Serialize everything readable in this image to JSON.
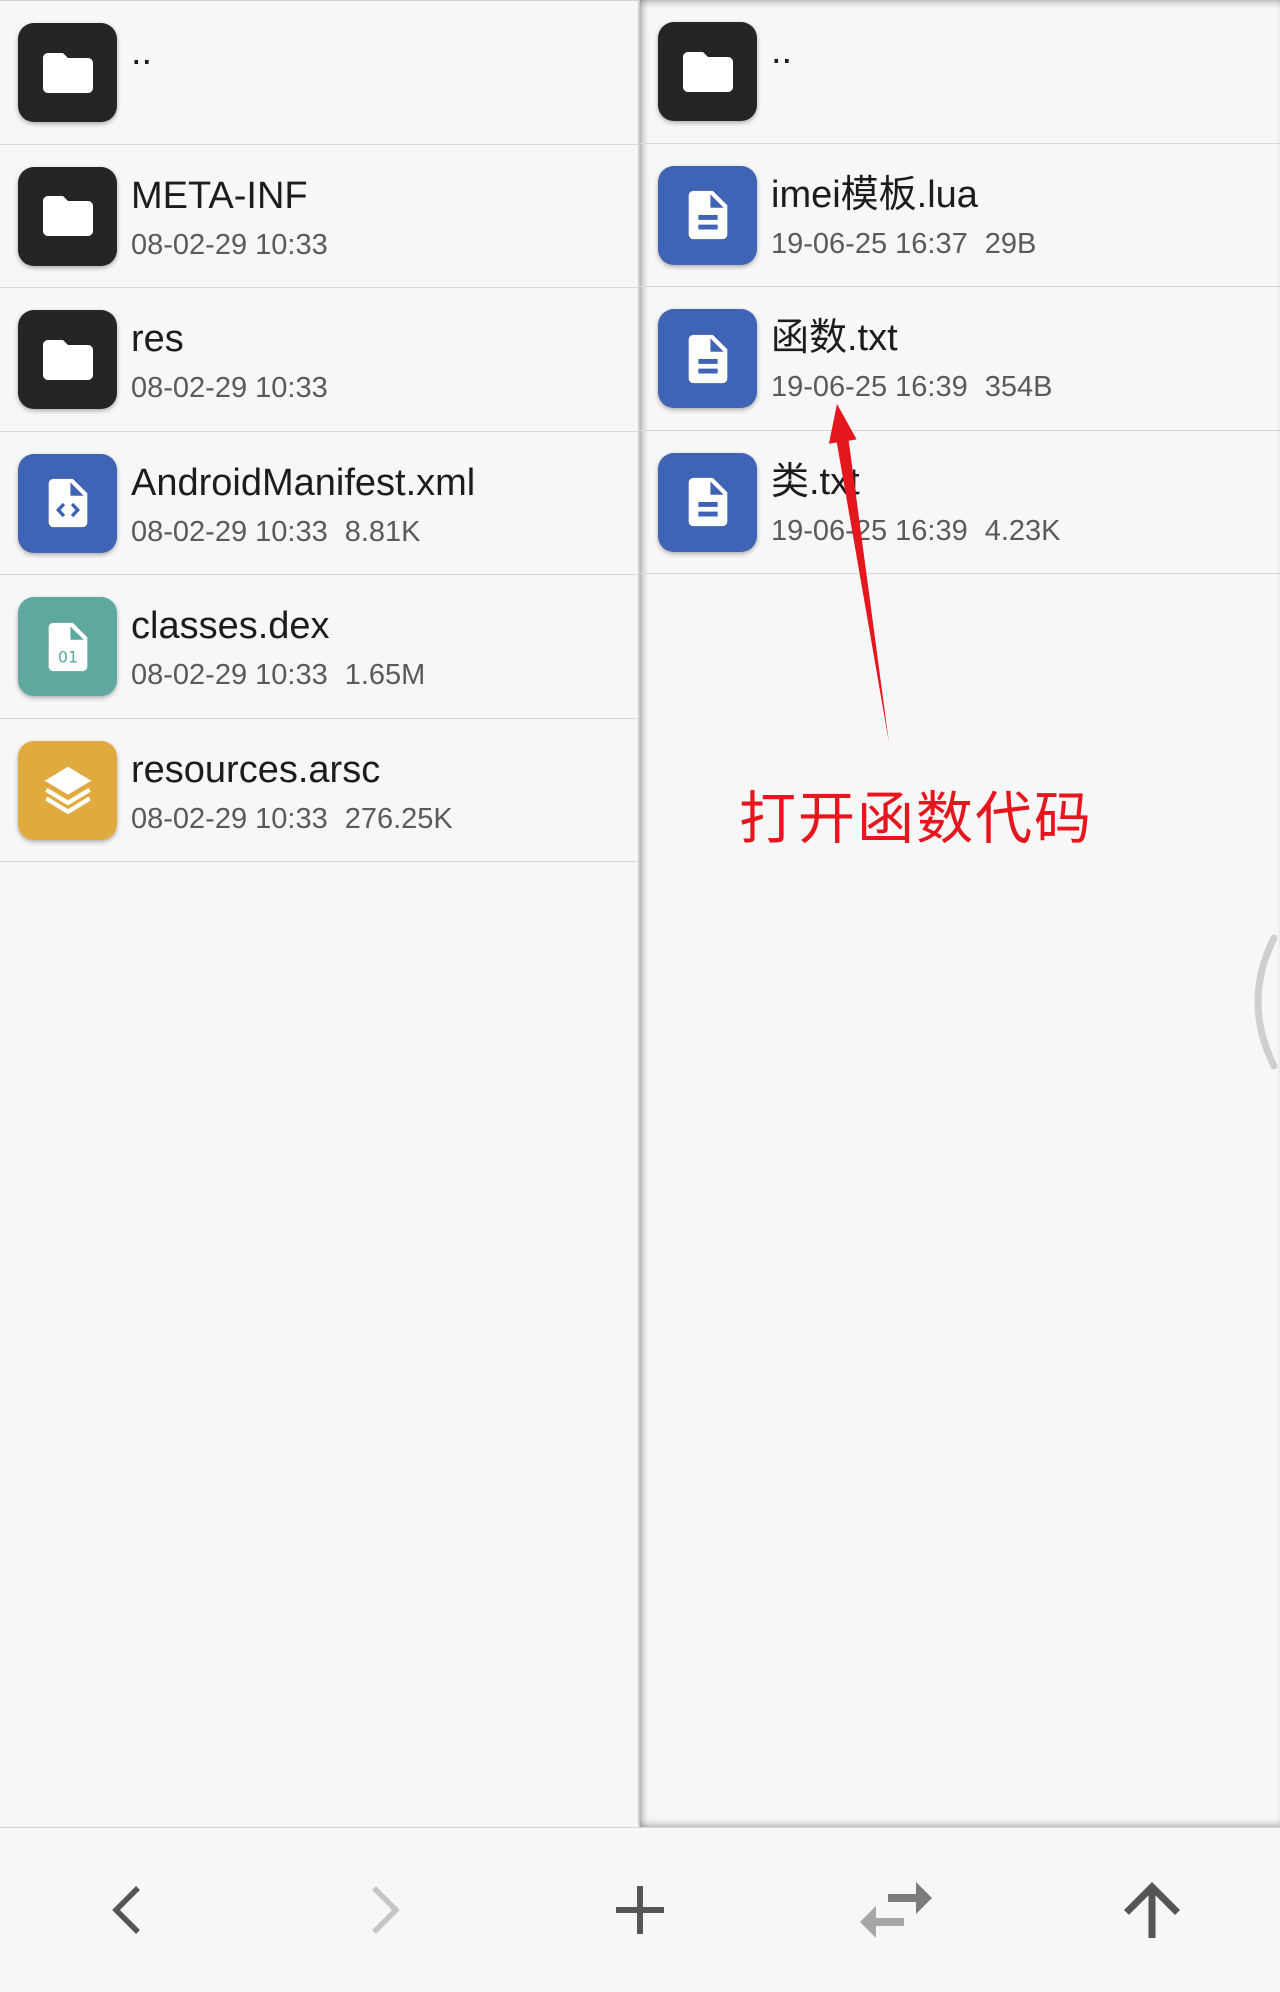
{
  "colors": {
    "background": "#f7f7f7",
    "folder": "#252525",
    "document": "#3f63b5",
    "dex": "#5fa8a0",
    "arsc": "#e0aa3e",
    "annotation": "#e5161e",
    "text_primary": "#1c1c1c",
    "text_secondary": "#5a5a5a"
  },
  "left_pane": {
    "items": [
      {
        "name": "..",
        "icon": "folder-icon"
      },
      {
        "name": "META-INF",
        "date": "08-02-29 10:33",
        "icon": "folder-icon"
      },
      {
        "name": "res",
        "date": "08-02-29 10:33",
        "icon": "folder-icon"
      },
      {
        "name": "AndroidManifest.xml",
        "date": "08-02-29 10:33",
        "size": "8.81K",
        "icon": "code-file-icon"
      },
      {
        "name": "classes.dex",
        "date": "08-02-29 10:33",
        "size": "1.65M",
        "icon": "binary-file-icon",
        "icon_text": "01"
      },
      {
        "name": "resources.arsc",
        "date": "08-02-29 10:33",
        "size": "276.25K",
        "icon": "layers-icon"
      }
    ]
  },
  "right_pane": {
    "items": [
      {
        "name": "..",
        "icon": "folder-icon"
      },
      {
        "name": "imei模板.lua",
        "date": "19-06-25 16:37",
        "size": "29B",
        "icon": "document-icon"
      },
      {
        "name": "函数.txt",
        "date": "19-06-25 16:39",
        "size": "354B",
        "icon": "document-icon"
      },
      {
        "name": "类.txt",
        "date": "19-06-25 16:39",
        "size": "4.23K",
        "icon": "document-icon"
      }
    ]
  },
  "annotation": {
    "text": "打开函数代码"
  },
  "bottom_bar": {
    "buttons": [
      {
        "icon": "chevron-left-icon",
        "enabled": true
      },
      {
        "icon": "chevron-right-icon",
        "enabled": false
      },
      {
        "icon": "add-icon",
        "enabled": true
      },
      {
        "icon": "swap-icon",
        "enabled": true
      },
      {
        "icon": "arrow-up-icon",
        "enabled": true
      }
    ]
  }
}
